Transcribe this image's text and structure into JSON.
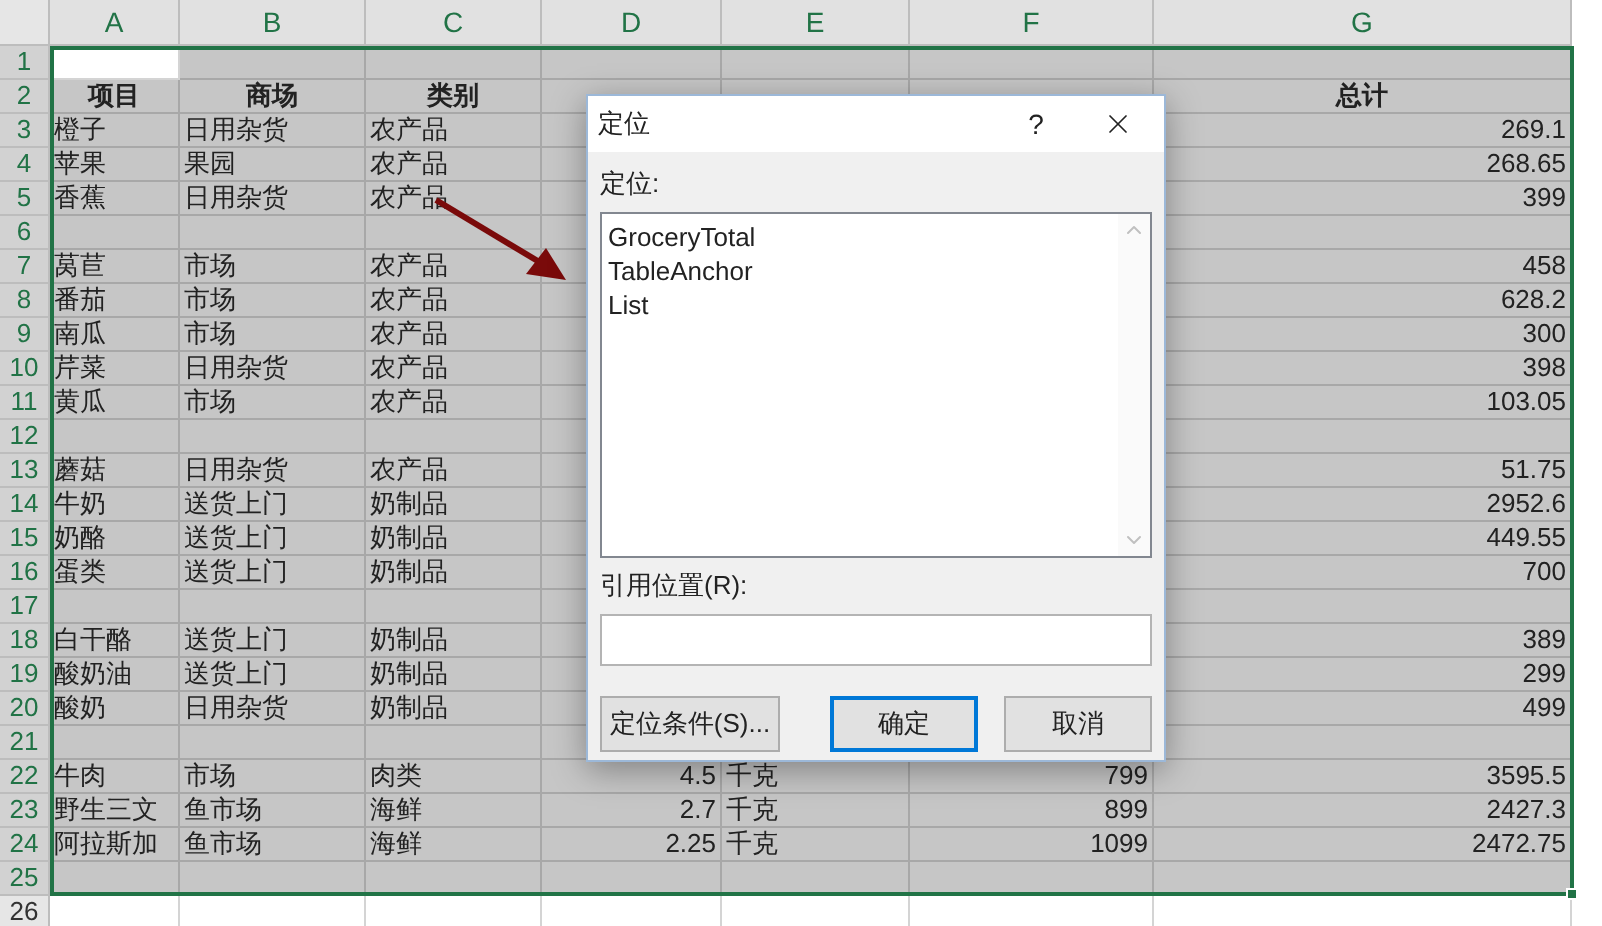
{
  "sheet": {
    "columns": [
      {
        "label": "A",
        "kind": "text"
      },
      {
        "label": "B",
        "kind": "text"
      },
      {
        "label": "C",
        "kind": "text"
      },
      {
        "label": "D",
        "kind": "number"
      },
      {
        "label": "E",
        "kind": "text"
      },
      {
        "label": "F",
        "kind": "number"
      },
      {
        "label": "G",
        "kind": "number"
      }
    ],
    "rows": [
      {
        "number": "1",
        "kind": "data",
        "selected": true,
        "active": true,
        "cells": [
          null,
          null,
          null,
          null,
          null,
          null,
          null
        ]
      },
      {
        "number": "2",
        "kind": "header",
        "selected": true,
        "active": false,
        "cells": [
          "项目",
          "商场",
          "类别",
          null,
          null,
          null,
          "总计"
        ]
      },
      {
        "number": "3",
        "kind": "data",
        "selected": true,
        "active": false,
        "cells": [
          "橙子",
          "日用杂货",
          "农产品",
          null,
          null,
          null,
          "269.1"
        ]
      },
      {
        "number": "4",
        "kind": "data",
        "selected": true,
        "active": false,
        "cells": [
          "苹果",
          "果园",
          "农产品",
          null,
          null,
          null,
          "268.65"
        ]
      },
      {
        "number": "5",
        "kind": "data",
        "selected": true,
        "active": false,
        "cells": [
          "香蕉",
          "日用杂货",
          "农产品",
          null,
          null,
          null,
          "399"
        ]
      },
      {
        "number": "6",
        "kind": "data",
        "selected": true,
        "active": false,
        "cells": [
          null,
          null,
          null,
          null,
          null,
          null,
          null
        ]
      },
      {
        "number": "7",
        "kind": "data",
        "selected": true,
        "active": false,
        "cells": [
          "莴苣",
          "市场",
          "农产品",
          null,
          null,
          null,
          "458"
        ]
      },
      {
        "number": "8",
        "kind": "data",
        "selected": true,
        "active": false,
        "cells": [
          "番茄",
          "市场",
          "农产品",
          null,
          null,
          null,
          "628.2"
        ]
      },
      {
        "number": "9",
        "kind": "data",
        "selected": true,
        "active": false,
        "cells": [
          "南瓜",
          "市场",
          "农产品",
          null,
          null,
          null,
          "300"
        ]
      },
      {
        "number": "10",
        "kind": "data",
        "selected": true,
        "active": false,
        "cells": [
          "芹菜",
          "日用杂货",
          "农产品",
          null,
          null,
          null,
          "398"
        ]
      },
      {
        "number": "11",
        "kind": "data",
        "selected": true,
        "active": false,
        "cells": [
          "黄瓜",
          "市场",
          "农产品",
          null,
          null,
          null,
          "103.05"
        ]
      },
      {
        "number": "12",
        "kind": "data",
        "selected": true,
        "active": false,
        "cells": [
          null,
          null,
          null,
          null,
          null,
          null,
          null
        ]
      },
      {
        "number": "13",
        "kind": "data",
        "selected": true,
        "active": false,
        "cells": [
          "蘑菇",
          "日用杂货",
          "农产品",
          null,
          null,
          null,
          "51.75"
        ]
      },
      {
        "number": "14",
        "kind": "data",
        "selected": true,
        "active": false,
        "cells": [
          "牛奶",
          "送货上门",
          "奶制品",
          null,
          null,
          null,
          "2952.6"
        ]
      },
      {
        "number": "15",
        "kind": "data",
        "selected": true,
        "active": false,
        "cells": [
          "奶酪",
          "送货上门",
          "奶制品",
          null,
          null,
          null,
          "449.55"
        ]
      },
      {
        "number": "16",
        "kind": "data",
        "selected": true,
        "active": false,
        "cells": [
          "蛋类",
          "送货上门",
          "奶制品",
          null,
          null,
          null,
          "700"
        ]
      },
      {
        "number": "17",
        "kind": "data",
        "selected": true,
        "active": false,
        "cells": [
          null,
          null,
          null,
          null,
          null,
          null,
          null
        ]
      },
      {
        "number": "18",
        "kind": "data",
        "selected": true,
        "active": false,
        "cells": [
          "白干酪",
          "送货上门",
          "奶制品",
          null,
          null,
          null,
          "389"
        ]
      },
      {
        "number": "19",
        "kind": "data",
        "selected": true,
        "active": false,
        "cells": [
          "酸奶油",
          "送货上门",
          "奶制品",
          null,
          null,
          null,
          "299"
        ]
      },
      {
        "number": "20",
        "kind": "data",
        "selected": true,
        "active": false,
        "cells": [
          "酸奶",
          "日用杂货",
          "奶制品",
          null,
          null,
          null,
          "499"
        ]
      },
      {
        "number": "21",
        "kind": "data",
        "selected": true,
        "active": false,
        "cells": [
          null,
          null,
          null,
          null,
          null,
          null,
          null
        ]
      },
      {
        "number": "22",
        "kind": "data",
        "selected": true,
        "active": false,
        "cells": [
          "牛肉",
          "市场",
          "肉类",
          "4.5",
          "千克",
          "799",
          "3595.5"
        ]
      },
      {
        "number": "23",
        "kind": "data",
        "selected": true,
        "active": false,
        "cells": [
          "野生三文",
          "鱼市场",
          "海鲜",
          "2.7",
          "千克",
          "899",
          "2427.3"
        ]
      },
      {
        "number": "24",
        "kind": "data",
        "selected": true,
        "active": false,
        "cells": [
          "阿拉斯加",
          "鱼市场",
          "海鲜",
          "2.25",
          "千克",
          "1099",
          "2472.75"
        ]
      },
      {
        "number": "25",
        "kind": "data",
        "selected": true,
        "active": false,
        "cells": [
          null,
          null,
          null,
          null,
          null,
          null,
          null
        ]
      },
      {
        "number": "26",
        "kind": "data",
        "selected": false,
        "active": false,
        "cells": [
          null,
          null,
          null,
          null,
          null,
          null,
          null
        ]
      }
    ]
  },
  "dialog": {
    "title": "定位",
    "help": "?",
    "list_label": "定位:",
    "list_items": [
      "GroceryTotal",
      "TableAnchor",
      "List"
    ],
    "reference_label": "引用位置(R):",
    "buttons": [
      {
        "label": "定位条件(S)...",
        "default": false
      },
      {
        "label": "确定",
        "default": true
      },
      {
        "label": "取消",
        "default": false
      }
    ]
  }
}
